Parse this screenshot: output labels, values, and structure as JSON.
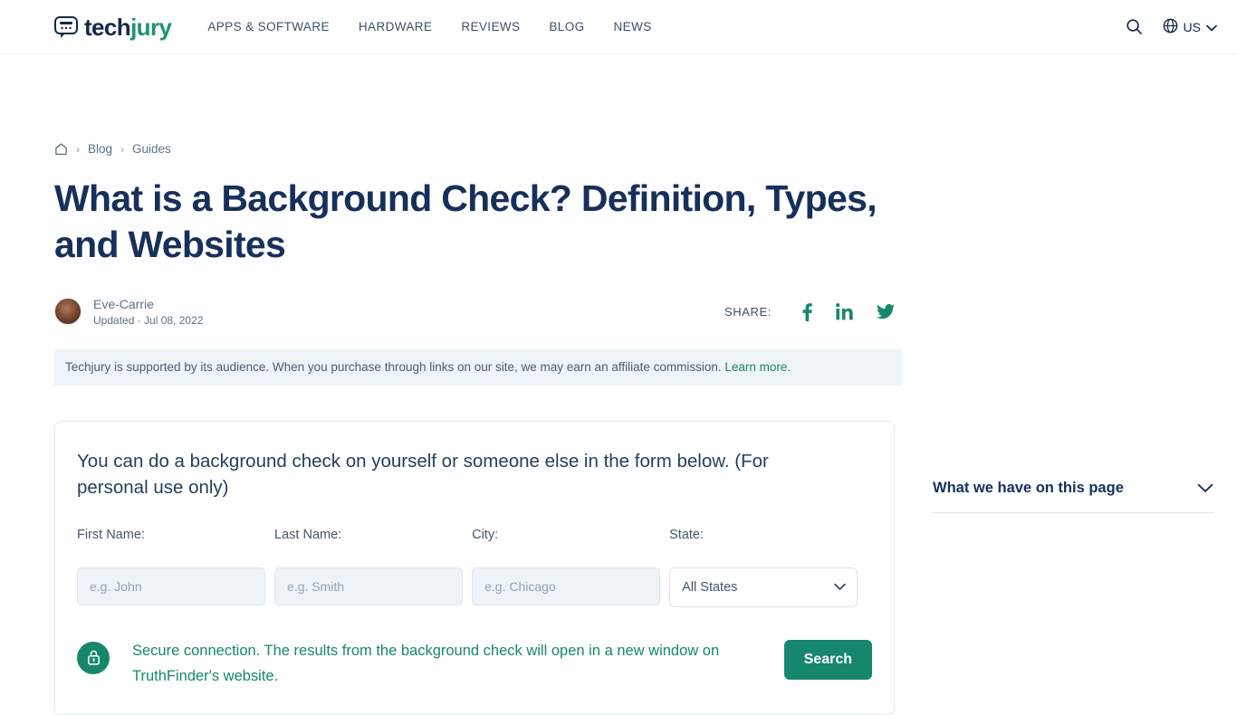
{
  "header": {
    "logo": {
      "part1": "tech",
      "part2": "jury",
      "icon": "chat-bubble-icon"
    },
    "nav": [
      {
        "label": "APPS & SOFTWARE"
      },
      {
        "label": "HARDWARE"
      },
      {
        "label": "REVIEWS"
      },
      {
        "label": "BLOG"
      },
      {
        "label": "NEWS"
      }
    ],
    "search_icon": "search-icon",
    "locale": {
      "icon": "globe-icon",
      "label": "US",
      "chevron": "chevron-down-icon"
    }
  },
  "breadcrumb": {
    "home_icon": "home-icon",
    "items": [
      {
        "label": "Blog"
      },
      {
        "label": "Guides"
      }
    ],
    "separator": "›"
  },
  "article": {
    "title": "What is a Background Check? Definition, Types, and Websites",
    "author": {
      "name": "Eve-Carrie",
      "updated": "Updated · Jul 08, 2022"
    },
    "share": {
      "label": "SHARE:",
      "networks": [
        "facebook-icon",
        "linkedin-icon",
        "twitter-icon"
      ]
    },
    "disclosure": {
      "text": "Techjury is supported by its audience. When you purchase through links on our site, we may earn an affiliate commission.",
      "link": "Learn more."
    }
  },
  "form": {
    "heading": "You can do a background check on yourself or someone else in the form below. (For personal use only)",
    "fields": [
      {
        "label": "First Name:",
        "placeholder": "e.g. John",
        "value": ""
      },
      {
        "label": "Last Name:",
        "placeholder": "e.g. Smith",
        "value": ""
      },
      {
        "label": "City:",
        "placeholder": "e.g. Chicago",
        "value": ""
      }
    ],
    "state": {
      "label": "State:",
      "selected": "All States",
      "options": [
        "All States"
      ]
    },
    "secure_note": "Secure connection. The results from the background check will open in a new window on TruthFinder's website.",
    "lock_icon": "lock-icon",
    "search_label": "Search"
  },
  "sidebar": {
    "toc_title": "What we have on this page",
    "toc_chevron": "chevron-down-icon"
  },
  "colors": {
    "brand_green": "#17876c",
    "navy": "#16305a",
    "muted": "#5d7086",
    "banner_bg": "#eef4f8",
    "input_bg": "#eef3f7"
  }
}
